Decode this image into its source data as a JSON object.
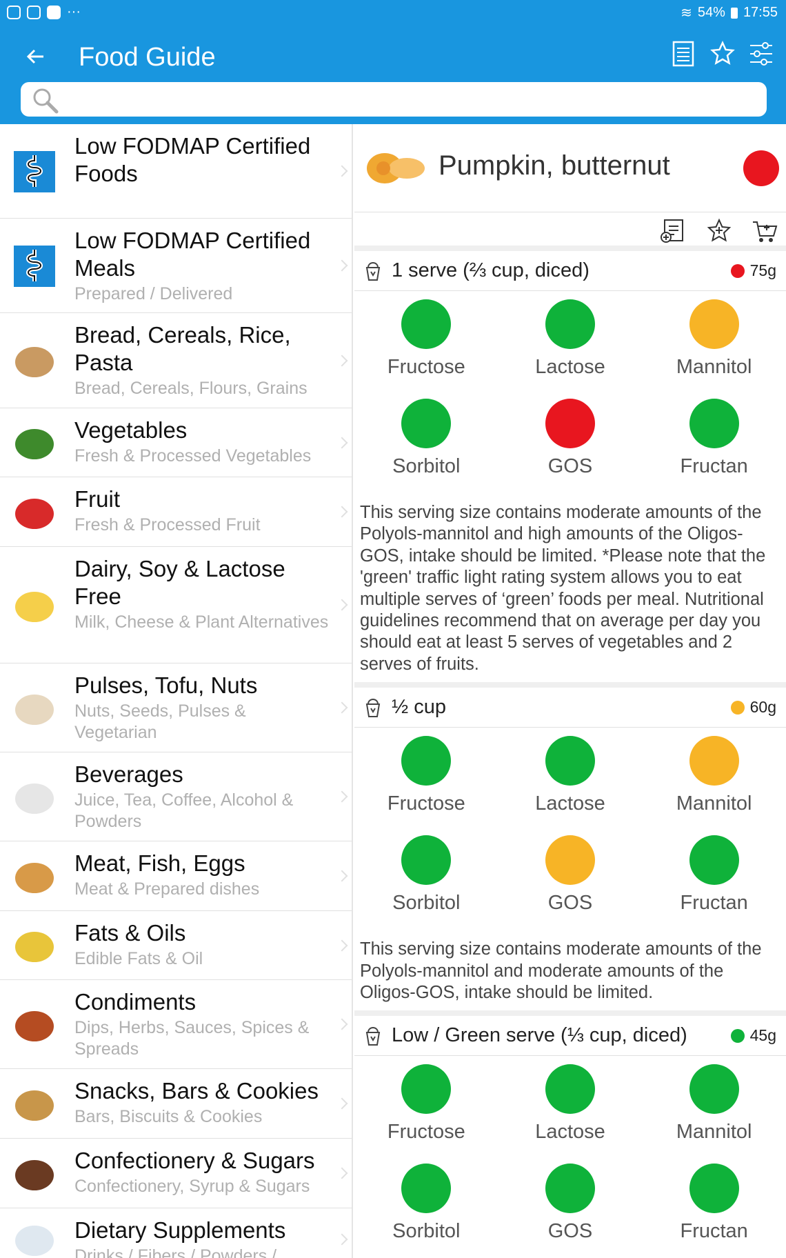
{
  "status_bar": {
    "battery": "54%",
    "time": "17:55"
  },
  "toolbar": {
    "title": "Food Guide"
  },
  "search": {
    "placeholder": ""
  },
  "colors": {
    "green": "#0fb23a",
    "orange": "#f7b426",
    "red": "#e8161f",
    "appbar": "#1996df"
  },
  "categories": [
    {
      "name": "Low FODMAP Certified Foods",
      "sub": "",
      "icon": "gut-logo-icon"
    },
    {
      "name": "Low FODMAP Certified Meals",
      "sub": "Prepared / Delivered",
      "icon": "gut-logo-icon"
    },
    {
      "name": "Bread, Cereals, Rice, Pasta",
      "sub": "Bread, Cereals, Flours, Grains",
      "icon": "bread-icon"
    },
    {
      "name": "Vegetables",
      "sub": "Fresh & Processed Vegetables",
      "icon": "broccoli-icon"
    },
    {
      "name": "Fruit",
      "sub": "Fresh & Processed Fruit",
      "icon": "strawberry-icon"
    },
    {
      "name": "Dairy, Soy & Lactose Free",
      "sub": "Milk, Cheese & Plant Alternatives",
      "icon": "cheese-icon"
    },
    {
      "name": "Pulses, Tofu, Nuts",
      "sub": "Nuts, Seeds, Pulses & Vegetarian",
      "icon": "tofu-bowl-icon"
    },
    {
      "name": "Beverages",
      "sub": "Juice, Tea, Coffee, Alcohol & Powders",
      "icon": "coffee-cup-icon"
    },
    {
      "name": "Meat, Fish, Eggs",
      "sub": "Meat & Prepared dishes",
      "icon": "chicken-leg-icon"
    },
    {
      "name": "Fats & Oils",
      "sub": "Edible Fats & Oil",
      "icon": "oil-bottle-icon"
    },
    {
      "name": "Condiments",
      "sub": "Dips, Herbs, Sauces, Spices & Spreads",
      "icon": "jam-jar-icon"
    },
    {
      "name": "Snacks, Bars & Cookies",
      "sub": "Bars, Biscuits & Cookies",
      "icon": "snack-bar-icon"
    },
    {
      "name": "Confectionery & Sugars",
      "sub": "Confectionery, Syrup & Sugars",
      "icon": "chocolate-icon"
    },
    {
      "name": "Dietary Supplements",
      "sub": "Drinks / Fibers / Powders /",
      "icon": "supplement-icon"
    }
  ],
  "food": {
    "name": "Pumpkin, butternut",
    "overall_rating": "red"
  },
  "serves": [
    {
      "label": "1 serve (⅔ cup, diced)",
      "weight": "75g",
      "rating": "red",
      "nutrients": [
        {
          "name": "Fructose",
          "rating": "green"
        },
        {
          "name": "Lactose",
          "rating": "green"
        },
        {
          "name": "Mannitol",
          "rating": "orange"
        },
        {
          "name": "Sorbitol",
          "rating": "green"
        },
        {
          "name": "GOS",
          "rating": "red"
        },
        {
          "name": "Fructan",
          "rating": "green"
        }
      ],
      "description": "This serving size contains moderate amounts of the Polyols-mannitol and high amounts of the Oligos-GOS, intake should be limited. *Please note that the 'green' traffic light rating system allows you to eat multiple serves of ‘green’ foods per meal. Nutritional guidelines recommend that on average per day you should eat at least 5 serves of vegetables and 2 serves of fruits."
    },
    {
      "label": "½ cup",
      "weight": "60g",
      "rating": "orange",
      "nutrients": [
        {
          "name": "Fructose",
          "rating": "green"
        },
        {
          "name": "Lactose",
          "rating": "green"
        },
        {
          "name": "Mannitol",
          "rating": "orange"
        },
        {
          "name": "Sorbitol",
          "rating": "green"
        },
        {
          "name": "GOS",
          "rating": "orange"
        },
        {
          "name": "Fructan",
          "rating": "green"
        }
      ],
      "description": "This serving size contains moderate amounts of the Polyols-mannitol and moderate amounts of the Oligos-GOS, intake should be limited."
    },
    {
      "label": "Low / Green serve (⅓ cup, diced)",
      "weight": "45g",
      "rating": "green",
      "nutrients": [
        {
          "name": "Fructose",
          "rating": "green"
        },
        {
          "name": "Lactose",
          "rating": "green"
        },
        {
          "name": "Mannitol",
          "rating": "green"
        },
        {
          "name": "Sorbitol",
          "rating": "green"
        },
        {
          "name": "GOS",
          "rating": "green"
        },
        {
          "name": "Fructan",
          "rating": "green"
        }
      ],
      "description": ""
    }
  ]
}
